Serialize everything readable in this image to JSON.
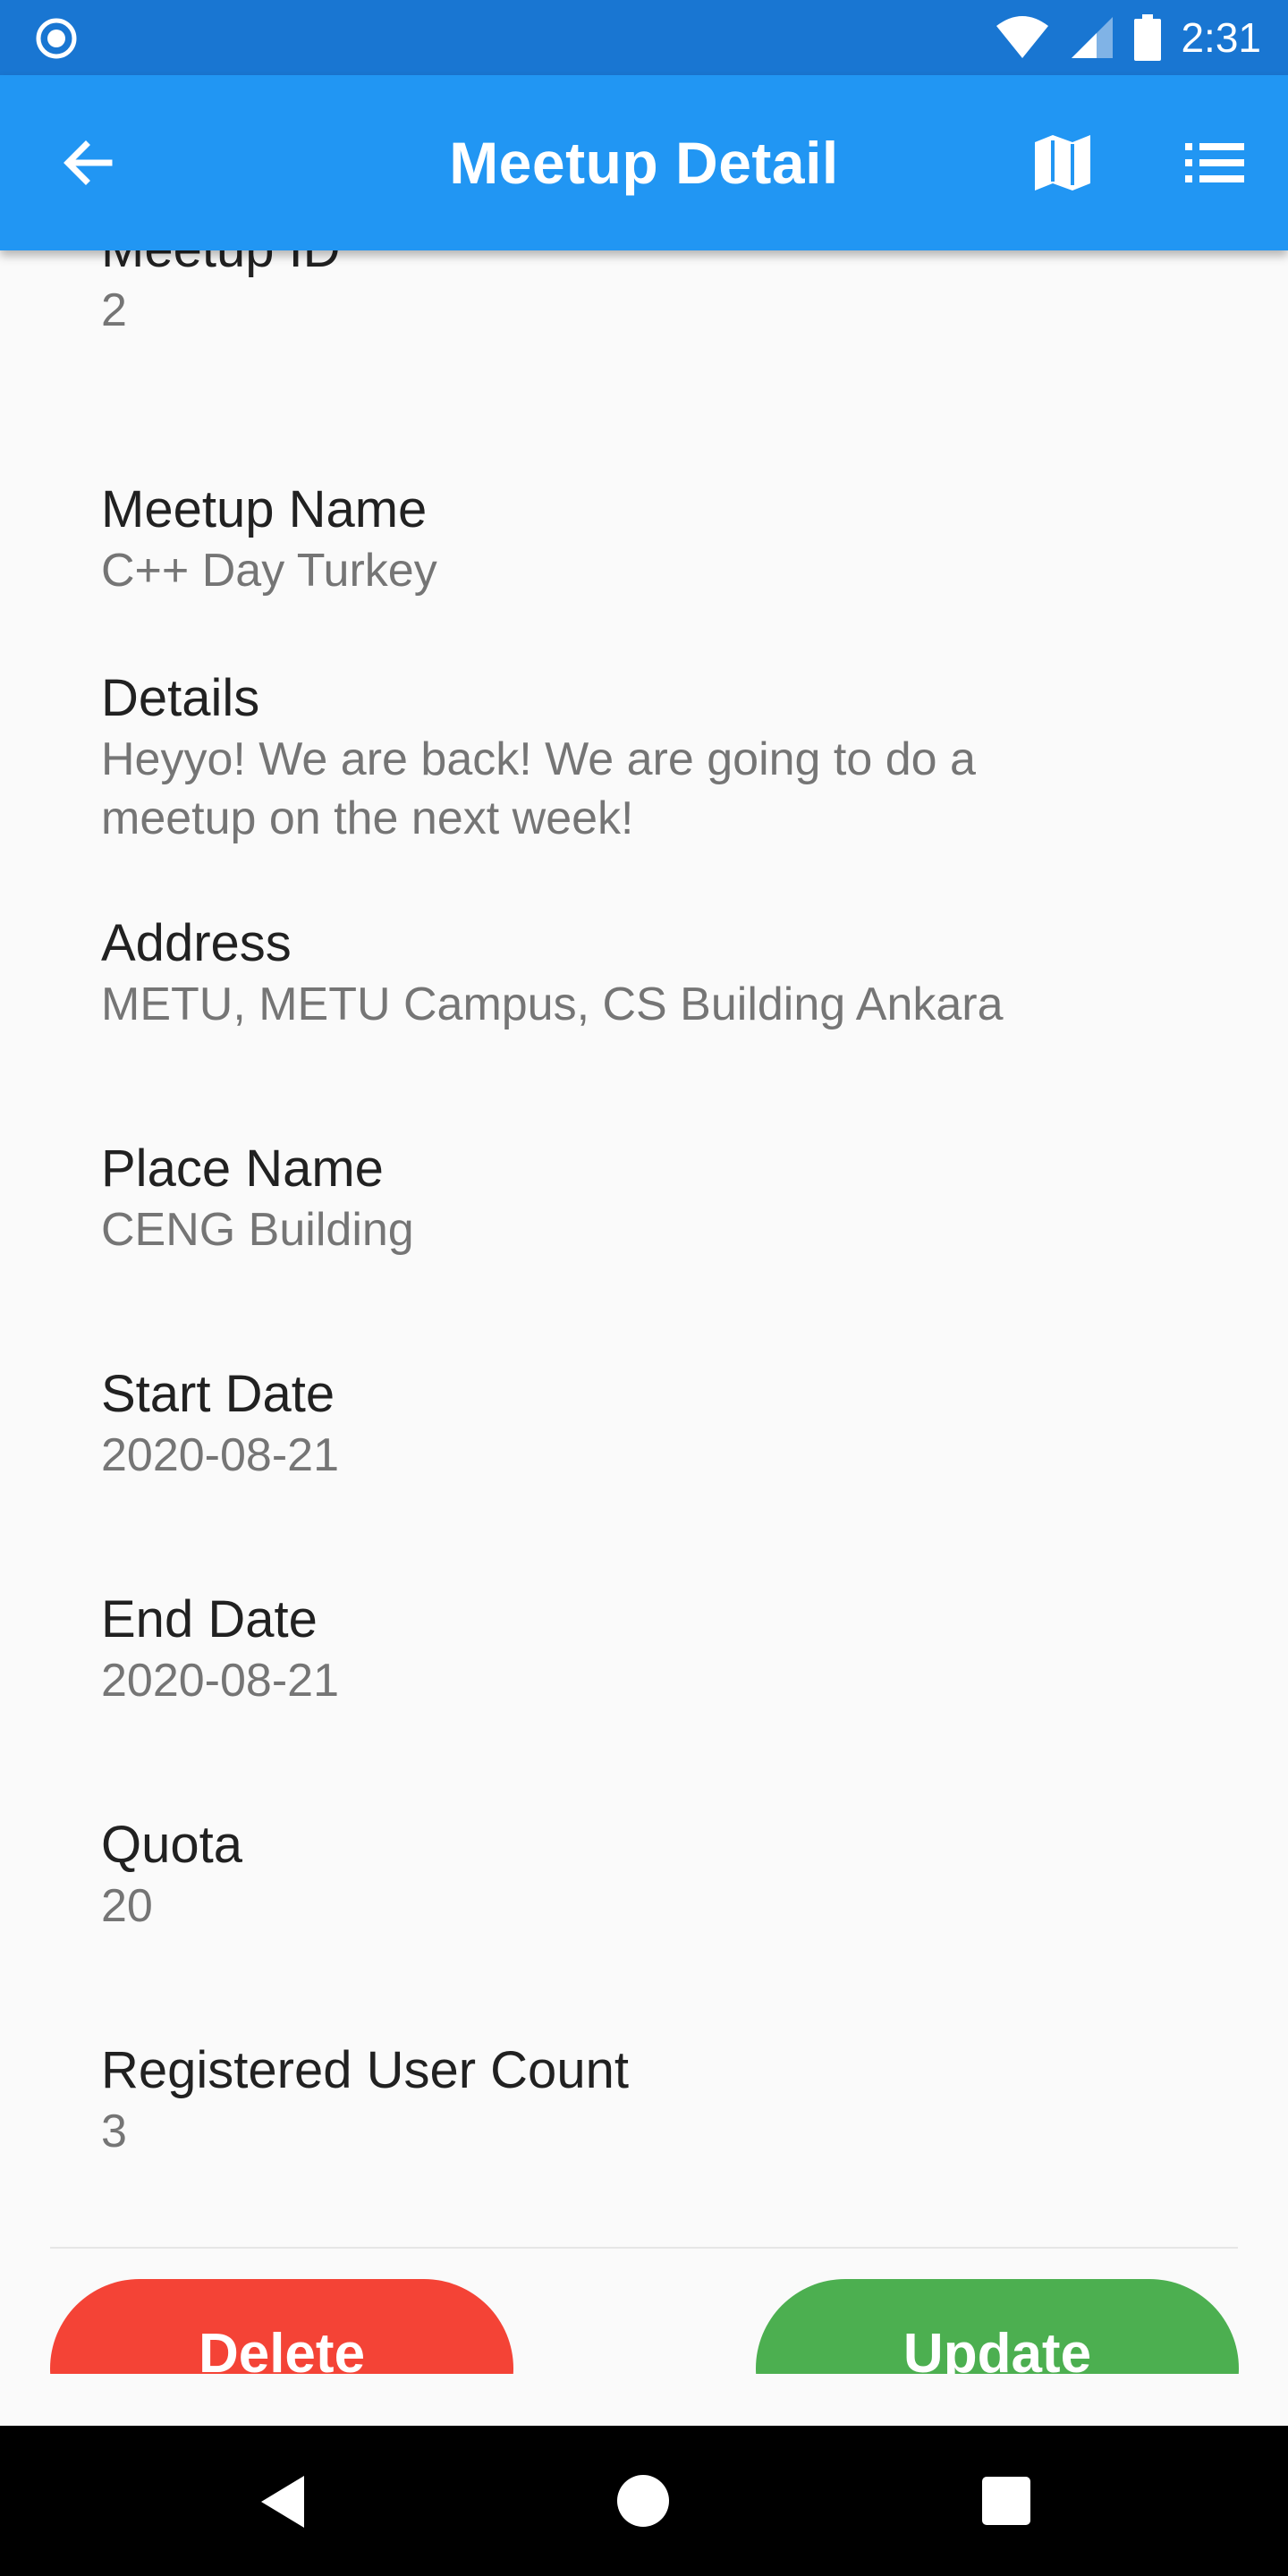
{
  "status_bar": {
    "time": "2:31",
    "icons": [
      "notification-dot-icon",
      "wifi-icon",
      "signal-icon",
      "battery-icon"
    ],
    "background_color": "#1976d2"
  },
  "app_bar": {
    "title": "Meetup Detail",
    "icons": [
      "back-arrow-icon",
      "map-icon",
      "list-icon"
    ],
    "background_color": "#2196f3"
  },
  "fields": [
    {
      "label": "Meetup ID",
      "value": "2"
    },
    {
      "label": "Meetup Name",
      "value": "C++ Day Turkey"
    },
    {
      "label": "Details",
      "value": "Heyyo! We are back! We are going to do a meetup on the next week!"
    },
    {
      "label": "Address",
      "value": "METU, METU Campus, CS Building Ankara"
    },
    {
      "label": "Place Name",
      "value": "CENG Building"
    },
    {
      "label": "Start Date",
      "value": "2020-08-21"
    },
    {
      "label": "End Date",
      "value": "2020-08-21"
    },
    {
      "label": "Quota",
      "value": "20"
    },
    {
      "label": "Registered User Count",
      "value": "3"
    }
  ],
  "actions": {
    "delete_label": "Delete",
    "update_label": "Update",
    "delete_color": "#f44336",
    "update_color": "#4caf50"
  },
  "nav_bar": {
    "icons": [
      "nav-back-icon",
      "nav-home-icon",
      "nav-recent-apps-icon"
    ]
  }
}
